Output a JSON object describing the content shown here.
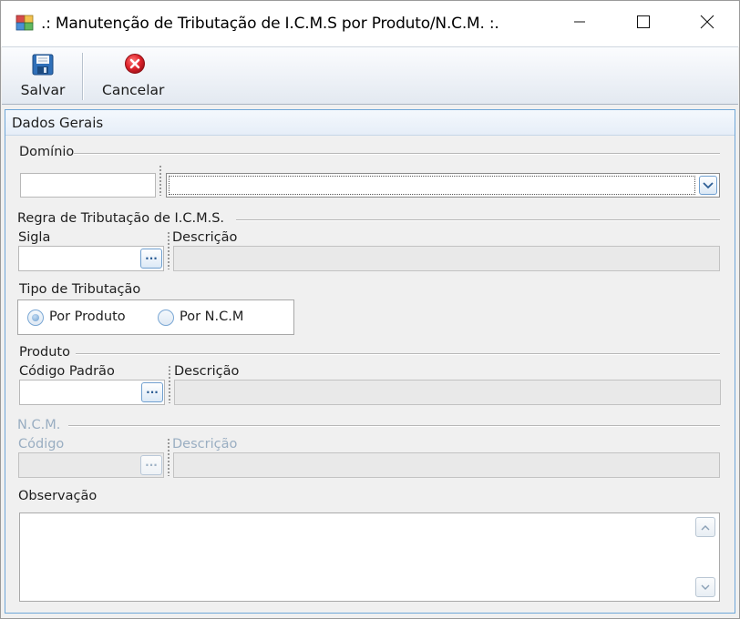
{
  "window": {
    "title": ".: Manutenção de Tributação de I.C.M.S por Produto/N.C.M. :.",
    "icons": {
      "app": "app-window-icon",
      "minimize": "minimize-icon",
      "maximize": "maximize-icon",
      "close": "close-icon"
    }
  },
  "toolbar": {
    "save_label": "Salvar",
    "cancel_label": "Cancelar",
    "save_icon": "floppy-disk-icon",
    "cancel_icon": "red-x-circle-icon"
  },
  "panel": {
    "title": "Dados Gerais"
  },
  "dominio": {
    "section_label": "Domínio",
    "code_value": "",
    "selected_value": ""
  },
  "regra": {
    "section_label": "Regra de Tributação de I.C.M.S.",
    "sigla_label": "Sigla",
    "descricao_label": "Descrição",
    "sigla_value": "",
    "descricao_value": "",
    "lookup_label": "···"
  },
  "tipo": {
    "section_label": "Tipo de Tributação",
    "options": [
      {
        "label": "Por Produto",
        "checked": true
      },
      {
        "label": "Por N.C.M",
        "checked": false
      }
    ]
  },
  "produto": {
    "section_label": "Produto",
    "codigo_label": "Código Padrão",
    "descricao_label": "Descrição",
    "codigo_value": "",
    "descricao_value": "",
    "lookup_label": "···"
  },
  "ncm": {
    "section_label": "N.C.M.",
    "codigo_label": "Código",
    "descricao_label": "Descrição",
    "codigo_value": "",
    "descricao_value": "",
    "lookup_label": "···",
    "enabled": false
  },
  "observacao": {
    "label": "Observação",
    "value": ""
  },
  "colors": {
    "accent_border": "#6fa7d8",
    "disabled_text": "#9aaec2",
    "cancel_red": "#e0242c"
  }
}
